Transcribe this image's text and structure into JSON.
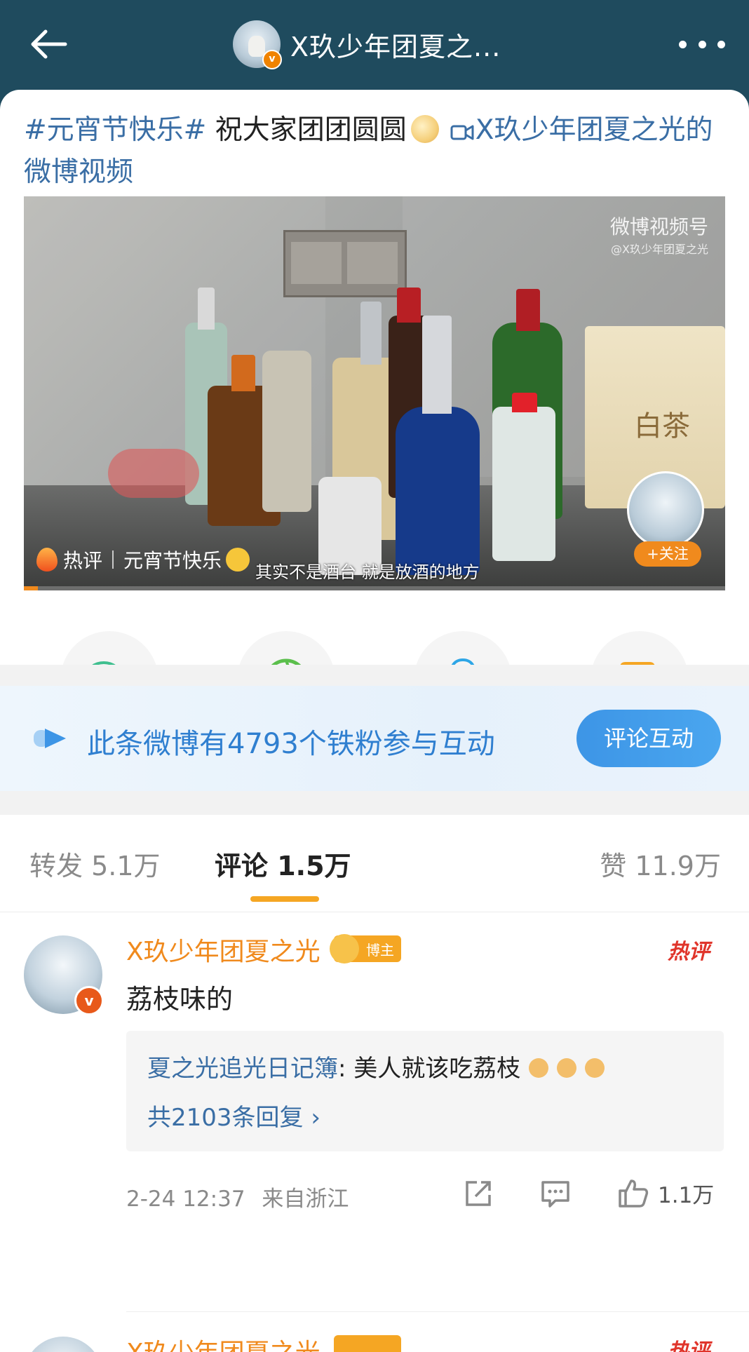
{
  "header": {
    "title": "X玖少年团夏之...",
    "verified_mark": "v"
  },
  "post": {
    "topic": "#元宵节快乐#",
    "text": " 祝大家团团圆圆",
    "video_link": "X玖少年团夏之光的微博视频"
  },
  "video": {
    "watermark_line1": "微博视频号",
    "watermark_line2": "@X玖少年团夏之光",
    "follow_label": "+关注",
    "hot_label": "热评",
    "hot_comment": "元宵节快乐",
    "subtitle": "其实不是酒台 就是放酒的地方",
    "tea_box_text": "白茶",
    "progress": 0.02
  },
  "share": {
    "icons": [
      "wechat-icon",
      "moments-icon",
      "qq-icon",
      "save-image-icon"
    ]
  },
  "fans_banner": {
    "text": "此条微博有4793个铁粉参与互动",
    "button": "评论互动"
  },
  "tabs": {
    "repost": "转发 5.1万",
    "comments": "评论 1.5万",
    "likes": "赞 11.9万"
  },
  "comment": {
    "author": "X玖少年团夏之光",
    "badge": "博主",
    "hot_tag": "热评",
    "text": "荔枝味的",
    "reply_author": "夏之光追光日记簿",
    "reply_text": ": 美人就该吃荔枝",
    "reply_count": "共2103条回复 ›",
    "time": "2-24 12:37",
    "location": "来自浙江",
    "likes": "1.1万",
    "verified_mark": "v"
  },
  "next_comment": {
    "author": "X玖少年团夏之光",
    "hot_tag": "热评"
  },
  "colors": {
    "header_bg": "#1f4b5e",
    "link_blue": "#3a6ea5",
    "orange": "#f08a1d",
    "fans_blue": "#2f7fd0",
    "hot_red": "#e0352b"
  }
}
